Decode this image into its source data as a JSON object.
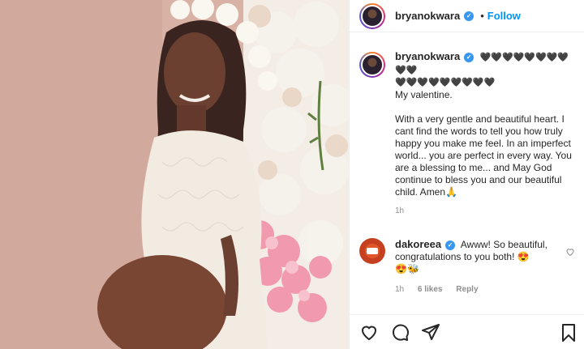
{
  "header": {
    "username": "bryanokwara",
    "separator": "•",
    "follow_label": "Follow"
  },
  "caption": {
    "username": "bryanokwara",
    "hearts_line1": "🖤🖤🖤🖤🖤🖤🖤🖤🖤🖤",
    "hearts_line2": "🖤🖤🖤🖤🖤🖤🖤🖤🖤",
    "line1": "My valentine.",
    "body": "With a very gentle and beautiful heart. I cant find the words to tell you how truly happy you make me feel. In an imperfect world... you are perfect in every way. You are a blessing to me... and May God continue to bless you and our beautiful child. Amen🙏",
    "time": "1h"
  },
  "comment": {
    "username": "dakoreea",
    "text": "Awww! So beautiful, congratulations to you both! 😍",
    "text_line2": "😍🐝",
    "time": "1h",
    "likes": "6 likes",
    "reply": "Reply"
  },
  "icons": {
    "like": "heart-icon",
    "comment": "comment-icon",
    "share": "share-icon",
    "save": "bookmark-icon",
    "verified": "verified-badge-icon"
  },
  "colors": {
    "accent": "#0095f6",
    "verified": "#3897f0",
    "secondary_text": "#8e8e8e"
  }
}
